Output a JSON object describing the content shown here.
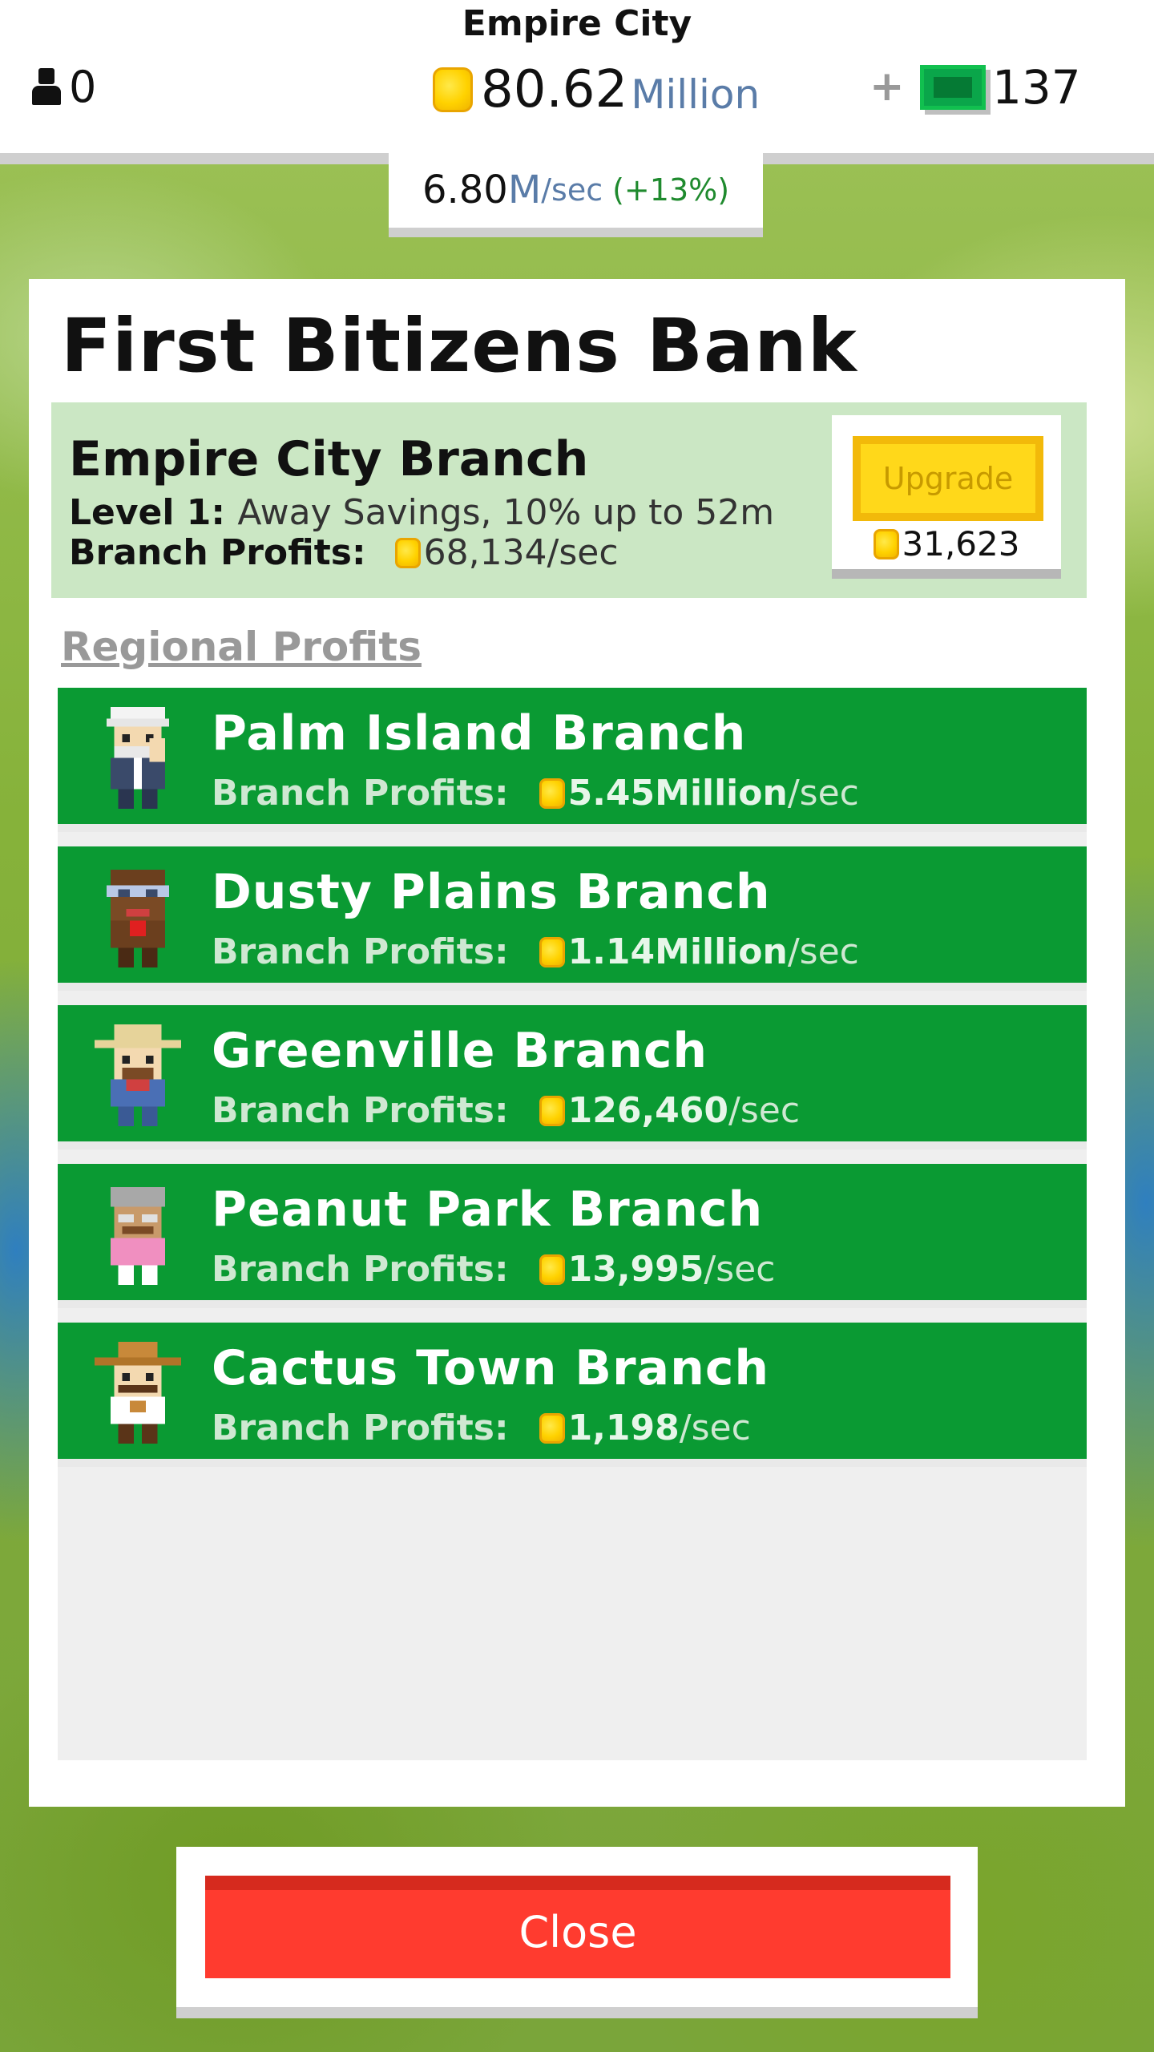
{
  "hud": {
    "city_name": "Empire City",
    "population": "0",
    "money_value": "80.62",
    "money_unit": "Million",
    "bux_plus": "+",
    "bux_count": "137",
    "rate_value": "6.80",
    "rate_unit": "M",
    "rate_per": "/sec",
    "rate_bonus": "(+13%)"
  },
  "panel": {
    "title": "First Bitizens Bank",
    "branch": {
      "name": "Empire City Branch",
      "level_label": "Level 1:",
      "level_desc": "Away Savings, 10% up to 52m",
      "profits_label": "Branch Profits:",
      "profits_value": "68,134/sec",
      "upgrade_label": "Upgrade",
      "upgrade_cost": "31,623"
    },
    "regional_title": "Regional Profits",
    "regions": [
      {
        "name": "Palm Island Branch",
        "label": "Branch Profits:",
        "amount": "5.45Million",
        "unit": "/sec"
      },
      {
        "name": "Dusty Plains Branch",
        "label": "Branch Profits:",
        "amount": "1.14Million",
        "unit": "/sec"
      },
      {
        "name": "Greenville Branch",
        "label": "Branch Profits:",
        "amount": "126,460",
        "unit": "/sec"
      },
      {
        "name": "Peanut Park Branch",
        "label": "Branch Profits:",
        "amount": "13,995",
        "unit": "/sec"
      },
      {
        "name": "Cactus Town Branch",
        "label": "Branch Profits:",
        "amount": "1,198",
        "unit": "/sec"
      }
    ]
  },
  "close_label": "Close",
  "colors": {
    "region_green": "#0a9a33",
    "branch_card": "#cbe7c4",
    "upgrade_yellow": "#ffd81a",
    "close_red": "#ff3b2f",
    "unit_blue": "#5a7ca8"
  },
  "icons": {
    "population": "person-icon",
    "money": "coin-icon",
    "bux": "bux-icon"
  }
}
